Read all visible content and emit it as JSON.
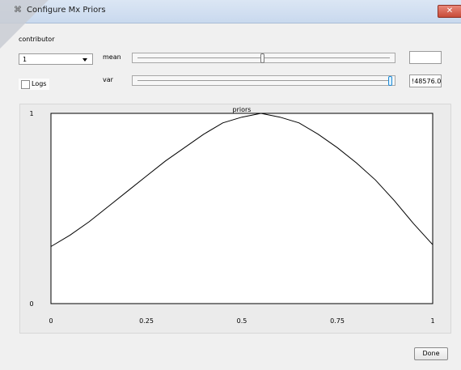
{
  "window": {
    "title": "Configure Mx Priors",
    "close_glyph": "✕"
  },
  "controls": {
    "contributor_label": "contributor",
    "contributor_value": "1",
    "logs_label": "Logs",
    "logs_checked": false,
    "mean_label": "mean",
    "mean_slider_fraction": 0.5,
    "var_label": "var",
    "var_slider_fraction": 1.0,
    "mean_value": "",
    "var_value": "!48576.0"
  },
  "chart_data": {
    "type": "line",
    "title": "priors",
    "xlabel": "",
    "ylabel": "",
    "xlim": [
      0,
      1
    ],
    "ylim": [
      0,
      1
    ],
    "x_ticks": [
      "0",
      "0.25",
      "0.5",
      "0.75",
      "1"
    ],
    "y_ticks": [
      "0",
      "1"
    ],
    "grid": false,
    "series": [
      {
        "x": [
          0,
          0.05,
          0.1,
          0.15,
          0.2,
          0.25,
          0.3,
          0.35,
          0.4,
          0.45,
          0.5,
          0.55,
          0.6,
          0.65,
          0.7,
          0.75,
          0.8,
          0.85,
          0.9,
          0.95,
          1
        ],
        "values": [
          0.3,
          0.36,
          0.43,
          0.51,
          0.59,
          0.67,
          0.75,
          0.82,
          0.89,
          0.95,
          0.98,
          1.0,
          0.98,
          0.95,
          0.89,
          0.82,
          0.74,
          0.65,
          0.54,
          0.42,
          0.31
        ]
      }
    ]
  },
  "footer": {
    "done_label": "Done"
  }
}
